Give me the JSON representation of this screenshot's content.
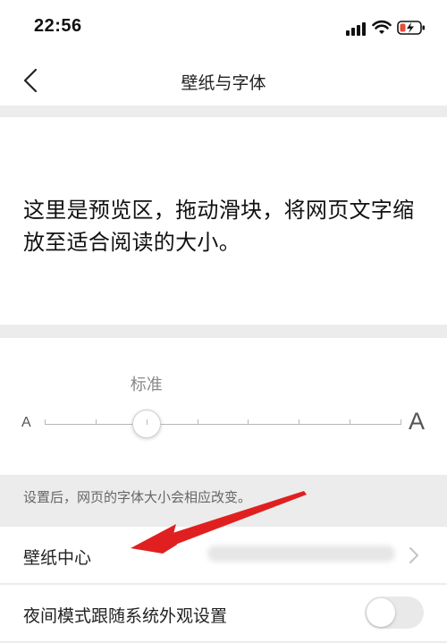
{
  "status_bar": {
    "time": "22:56",
    "icons": [
      "signal-icon",
      "wifi-icon",
      "battery-charging-icon"
    ],
    "battery_color": "#e74c3c"
  },
  "nav": {
    "title": "壁纸与字体",
    "back_icon": "chevron-left-icon"
  },
  "preview": {
    "text": "这里是预览区，拖动滑块，将网页文字缩放至适合阅读的大小。"
  },
  "font_size": {
    "current_label": "标准",
    "small_label": "A",
    "large_label": "A",
    "steps": 8,
    "selected_step": 3
  },
  "hint": "设置后，网页的字体大小会相应改变。",
  "settings": {
    "wallpaper_label": "壁纸中心",
    "night_mode_label": "夜间模式跟随系统外观设置",
    "night_mode_on": false
  },
  "annotation": {
    "arrow_color": "#e02020",
    "icon": "red-arrow"
  }
}
